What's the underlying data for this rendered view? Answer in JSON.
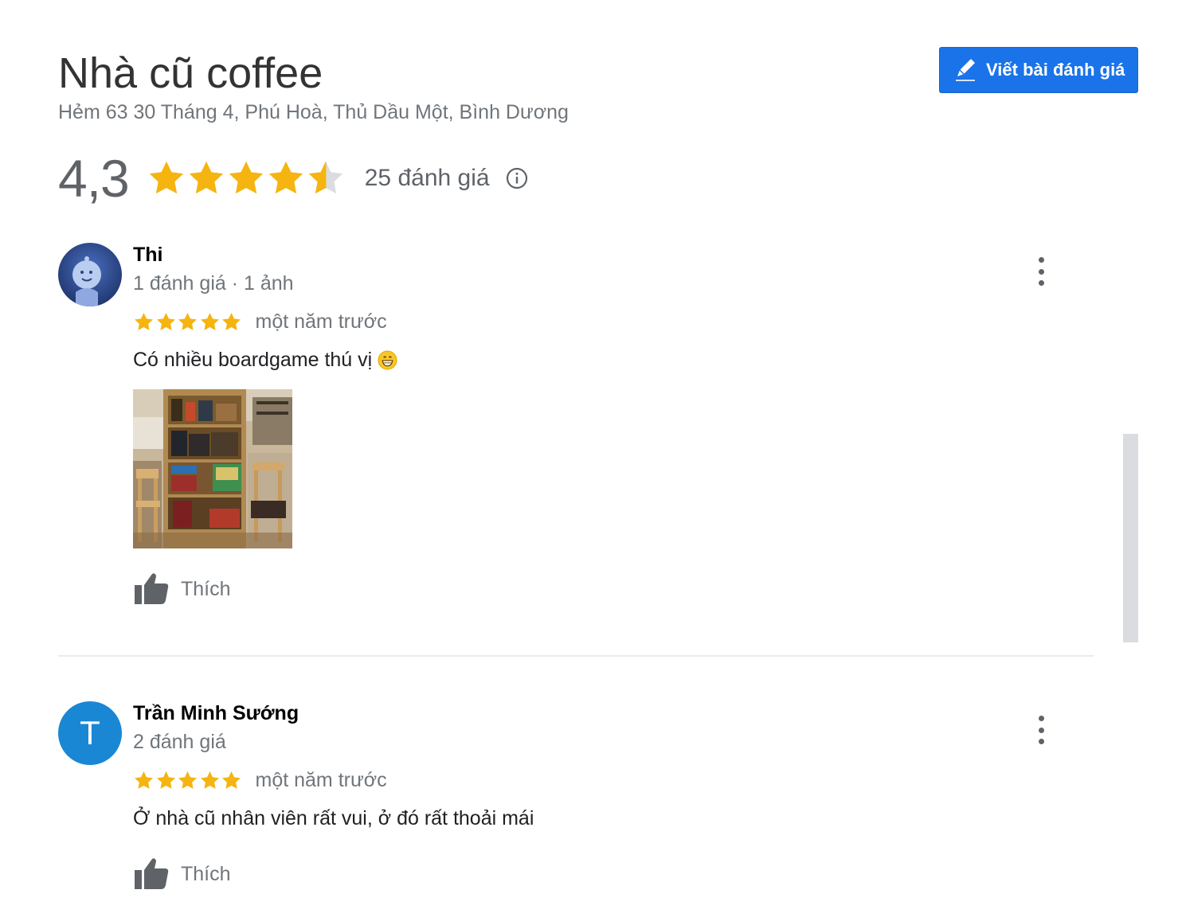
{
  "place": {
    "title": "Nhà cũ coffee",
    "address": "Hẻm 63 30 Tháng 4, Phú Hoà, Thủ Dầu Một, Bình Dương",
    "rating": "4,3",
    "rating_value": 4.3,
    "review_count": "25 đánh giá"
  },
  "write_review": {
    "label": "Viết bài đánh giá",
    "icon": "pencil-icon"
  },
  "colors": {
    "star": "#f5b40f",
    "star_empty": "#dadce0",
    "button": "#1a73e8",
    "avatar_letter_bg": "#1a87d4"
  },
  "reviews": [
    {
      "author": "Thi",
      "meta": "1 đánh giá · 1 ảnh",
      "stars": 5,
      "time": "một năm trước",
      "text": "Có nhiều boardgame thú vị",
      "emoji": "grinning-face-emoji",
      "like_label": "Thích"
    },
    {
      "author": "Trần Minh Sướng",
      "avatar_letter": "T",
      "meta": "2 đánh giá",
      "stars": 5,
      "time": "một năm trước",
      "text": "Ở nhà cũ nhân viên rất vui, ở đó rất thoải mái",
      "like_label": "Thích"
    }
  ]
}
